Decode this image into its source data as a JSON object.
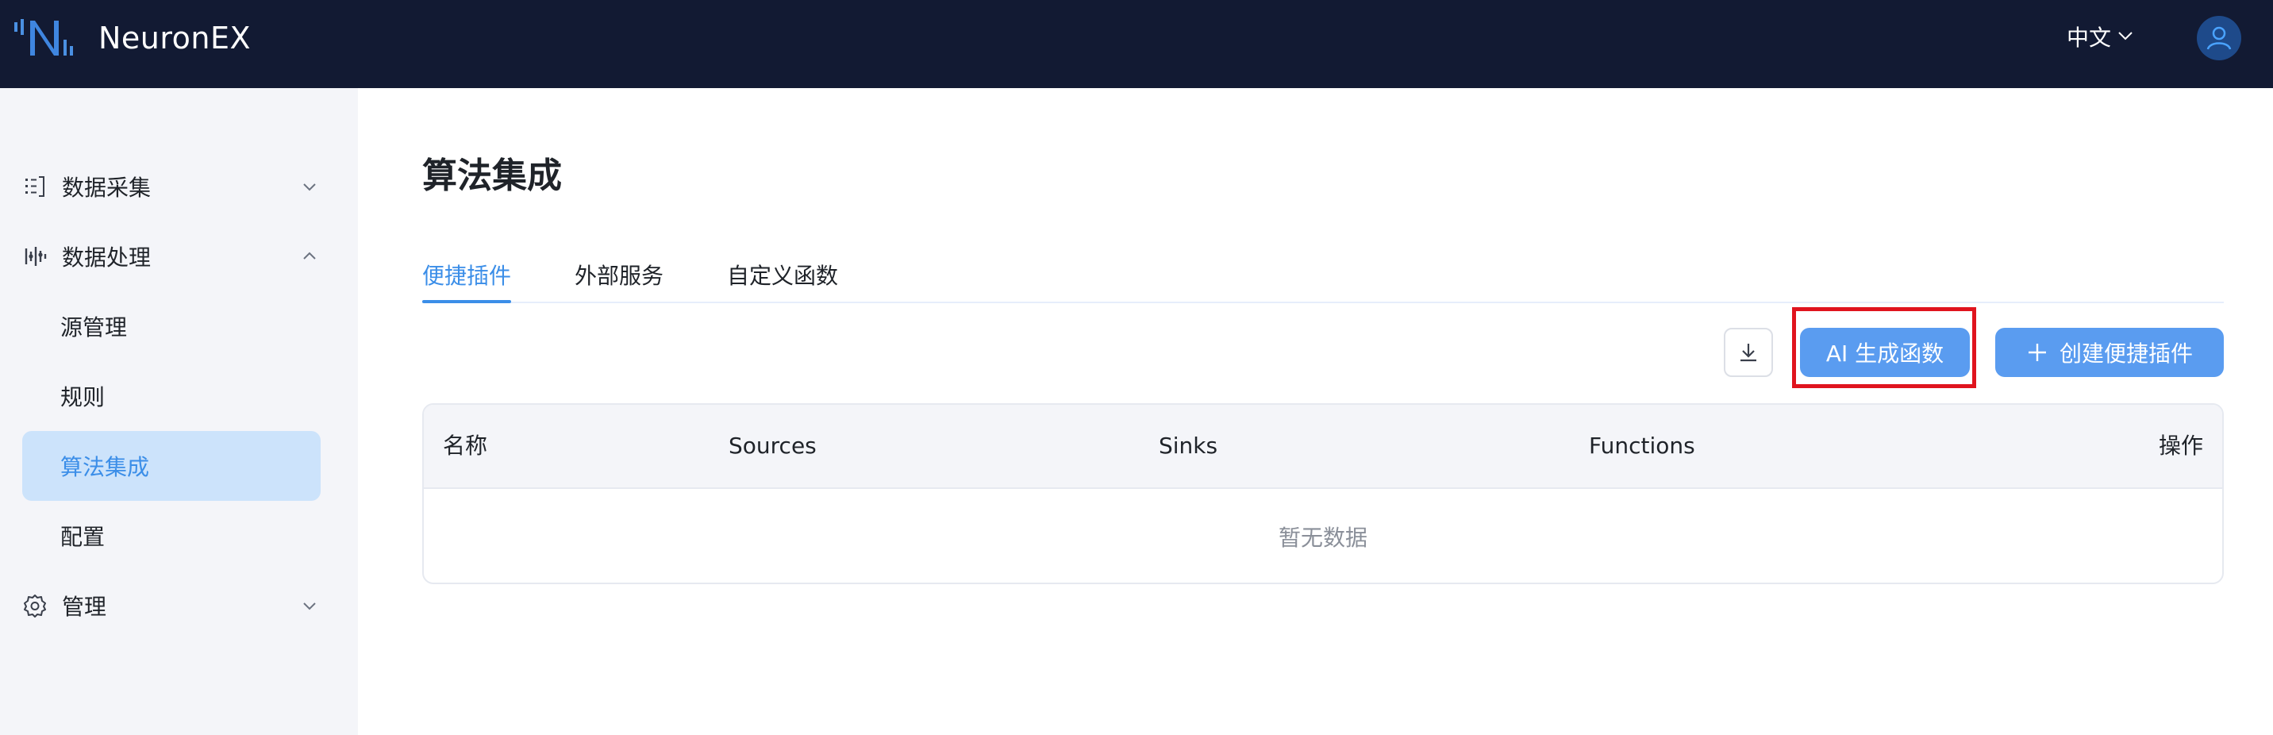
{
  "app": {
    "brand": "NeuronEX"
  },
  "header": {
    "language": "中文"
  },
  "sidebar": {
    "items": [
      {
        "label": "数据采集",
        "icon": "data-collection-icon",
        "expanded": false
      },
      {
        "label": "数据处理",
        "icon": "data-processing-icon",
        "expanded": true
      },
      {
        "label": "源管理"
      },
      {
        "label": "规则"
      },
      {
        "label": "算法集成",
        "active": true
      },
      {
        "label": "配置"
      },
      {
        "label": "管理",
        "icon": "gear-icon",
        "expanded": false
      }
    ]
  },
  "main": {
    "title": "算法集成",
    "tabs": [
      {
        "label": "便捷插件",
        "active": true
      },
      {
        "label": "外部服务"
      },
      {
        "label": "自定义函数"
      }
    ],
    "toolbar": {
      "ai_label": "AI 生成函数",
      "create_label": "创建便捷插件"
    },
    "table": {
      "columns": [
        "名称",
        "Sources",
        "Sinks",
        "Functions",
        "操作"
      ],
      "empty_text": "暂无数据"
    }
  },
  "colors": {
    "topbar": "#121a33",
    "sidebar": "#f4f5f9",
    "accent": "#3b8ee8",
    "button": "#5a9cf0",
    "highlight": "#e0141e"
  }
}
